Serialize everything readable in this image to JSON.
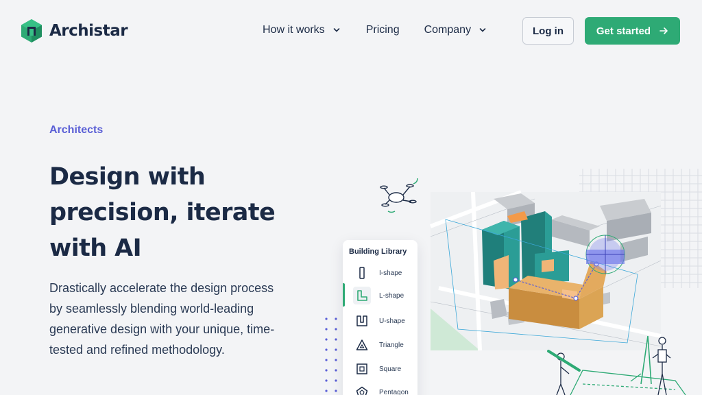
{
  "brand": {
    "name": "Archistar",
    "accent": "#2eaa75",
    "navy": "#1b2a45",
    "eyebrow_color": "#5a5fd6"
  },
  "nav": {
    "items": [
      {
        "label": "How it works",
        "has_dropdown": true
      },
      {
        "label": "Pricing",
        "has_dropdown": false
      },
      {
        "label": "Company",
        "has_dropdown": true
      }
    ],
    "login_label": "Log in",
    "cta_label": "Get started"
  },
  "hero": {
    "eyebrow": "Architects",
    "headline_line1": "Design with",
    "headline_line2": "precision, iterate",
    "headline_line3": "with AI",
    "lede": "Drastically accelerate the design process by seamlessly blending world-leading generative design with your unique, time-tested and refined methodology."
  },
  "library": {
    "title": "Building Library",
    "items": [
      {
        "label": "I-shape",
        "icon": "i-shape-icon"
      },
      {
        "label": "L-shape",
        "icon": "l-shape-icon",
        "active": true
      },
      {
        "label": "U-shape",
        "icon": "u-shape-icon"
      },
      {
        "label": "Triangle",
        "icon": "triangle-icon"
      },
      {
        "label": "Square",
        "icon": "square-icon"
      },
      {
        "label": "Pentagon",
        "icon": "pentagon-icon"
      }
    ]
  }
}
